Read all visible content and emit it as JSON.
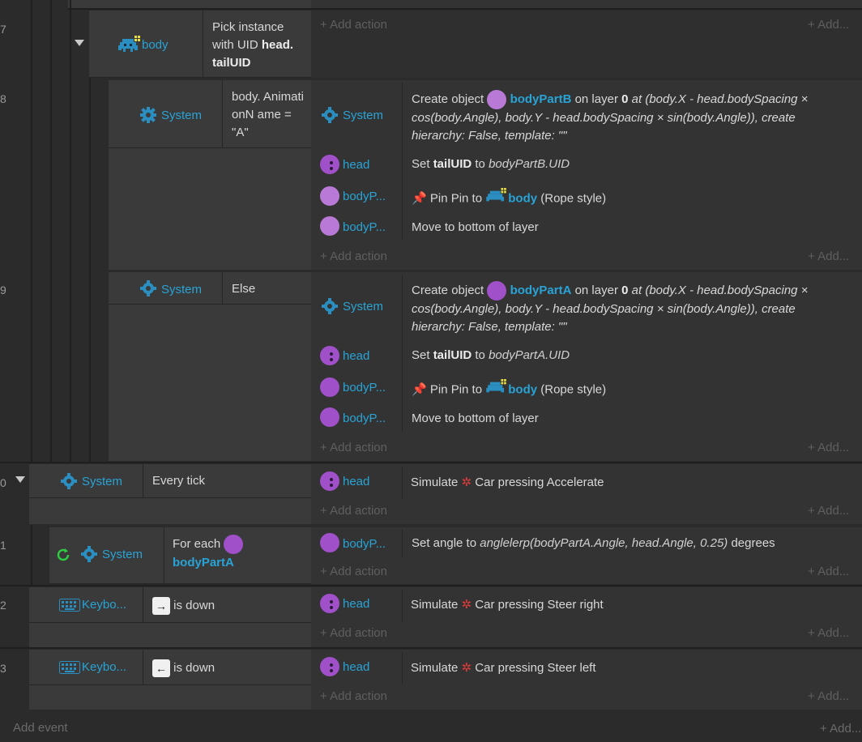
{
  "rows": {
    "r7": "7",
    "r8": "8",
    "r9": "9",
    "r10": "0",
    "r11": "1",
    "r12": "2",
    "r13": "3"
  },
  "common": {
    "add_action": "+ Add action",
    "add_right": "+ Add...",
    "add_event": "Add event",
    "add_event_right": "+ Add...",
    "system": "System"
  },
  "ev7": {
    "object": "body",
    "cond_prefix": "Pick instance with UID",
    "cond_bold": "head. tailUID"
  },
  "ev8": {
    "cond_text": "body. AnimationN ame = \"A\"",
    "act1_obj": "System",
    "act1_text_a": "Create object",
    "act1_obj_ref": "bodyPartB",
    "act1_text_b": "on layer",
    "act1_layer": "0",
    "act1_text_c": "at (body.X - head.bodySpacing × cos(body.Angle), body.Y - head.bodySpacing × sin(body.Angle)), create hierarchy: False, template: \"\"",
    "act2_obj": "head",
    "act2_text_a": "Set",
    "act2_var": "tailUID",
    "act2_text_b": "to",
    "act2_expr": "bodyPartB.UID",
    "act3_obj": "bodyP...",
    "act3_text_a": "Pin Pin to",
    "act3_target": "body",
    "act3_text_b": "(Rope style)",
    "act4_obj": "bodyP...",
    "act4_text": "Move to bottom of layer"
  },
  "ev9": {
    "cond_text": "Else",
    "act1_obj": "System",
    "act1_text_a": "Create object",
    "act1_obj_ref": "bodyPartA",
    "act1_text_b": "on layer",
    "act1_layer": "0",
    "act1_text_c": "at (body.X - head.bodySpacing × cos(body.Angle), body.Y - head.bodySpacing × sin(body.Angle)), create hierarchy: False, template: \"\"",
    "act2_obj": "head",
    "act2_text_a": "Set",
    "act2_var": "tailUID",
    "act2_text_b": "to",
    "act2_expr": "bodyPartA.UID",
    "act3_obj": "bodyP...",
    "act3_text_a": "Pin Pin to",
    "act3_target": "body",
    "act3_text_b": "(Rope style)",
    "act4_obj": "bodyP...",
    "act4_text": "Move to bottom of layer"
  },
  "ev10": {
    "cond_text": "Every tick",
    "act_obj": "head",
    "act_text_a": "Simulate",
    "act_text_b": "Car pressing Accelerate"
  },
  "ev11": {
    "cond_prefix": "For each",
    "cond_obj": "bodyPartA",
    "act_obj": "bodyP...",
    "act_text_a": "Set angle to",
    "act_expr": "anglelerp(bodyPartA.Angle, head.Angle, 0.25)",
    "act_text_b": "degrees"
  },
  "ev12": {
    "cond_obj": "Keybo...",
    "key": "→",
    "cond_text": "is down",
    "act_obj": "head",
    "act_text_a": "Simulate",
    "act_text_b": "Car pressing Steer right"
  },
  "ev13": {
    "cond_obj": "Keybo...",
    "key": "←",
    "cond_text": "is down",
    "act_obj": "head",
    "act_text_a": "Simulate",
    "act_text_b": "Car pressing Steer left"
  },
  "colors": {
    "object_blue": "#29a3d6",
    "sprite_purple": "#a050c8",
    "gear_blue": "#2a8fc0",
    "loop_green": "#2ecc40",
    "car_red": "#e03a3a"
  },
  "icons": [
    "gear-icon",
    "sprite-ball-icon",
    "invader-sprite-icon",
    "pin-icon",
    "car-behavior-icon",
    "keyboard-icon",
    "loop-icon",
    "chevron-down-icon"
  ]
}
